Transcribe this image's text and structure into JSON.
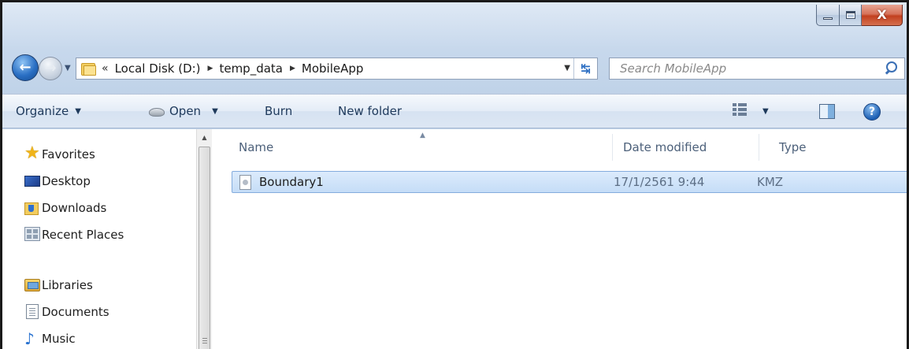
{
  "window": {
    "caption_buttons": {
      "minimize_icon": "minimize-icon",
      "maximize_icon": "maximize-icon",
      "close_glyph": "X"
    }
  },
  "navigation": {
    "back_glyph": "←",
    "forward_glyph": "→",
    "path_overflow": "«",
    "breadcrumbs": [
      {
        "label": "Local Disk (D:)"
      },
      {
        "label": "temp_data"
      },
      {
        "label": "MobileApp"
      }
    ],
    "search_placeholder": "Search MobileApp"
  },
  "toolbar": {
    "organize": "Organize",
    "open": "Open",
    "burn": "Burn",
    "new_folder": "New folder",
    "help_glyph": "?"
  },
  "navpane": {
    "favorites_label": "Favorites",
    "favorites": [
      {
        "label": "Desktop",
        "icon": "desktop-icon"
      },
      {
        "label": "Downloads",
        "icon": "downloads-folder-icon"
      },
      {
        "label": "Recent Places",
        "icon": "recent-places-icon"
      }
    ],
    "libraries_label": "Libraries",
    "libraries": [
      {
        "label": "Documents",
        "icon": "documents-icon"
      },
      {
        "label": "Music",
        "icon": "music-icon"
      }
    ]
  },
  "filelist": {
    "columns": {
      "name": "Name",
      "date_modified": "Date modified",
      "type": "Type"
    },
    "rows": [
      {
        "name": "Boundary1",
        "date_modified": "17/1/2561 9:44",
        "type": "KMZ",
        "selected": true
      }
    ]
  },
  "colors": {
    "accent": "#1e395b",
    "selection": "#c5ddf7",
    "close_button": "#c2401f"
  }
}
